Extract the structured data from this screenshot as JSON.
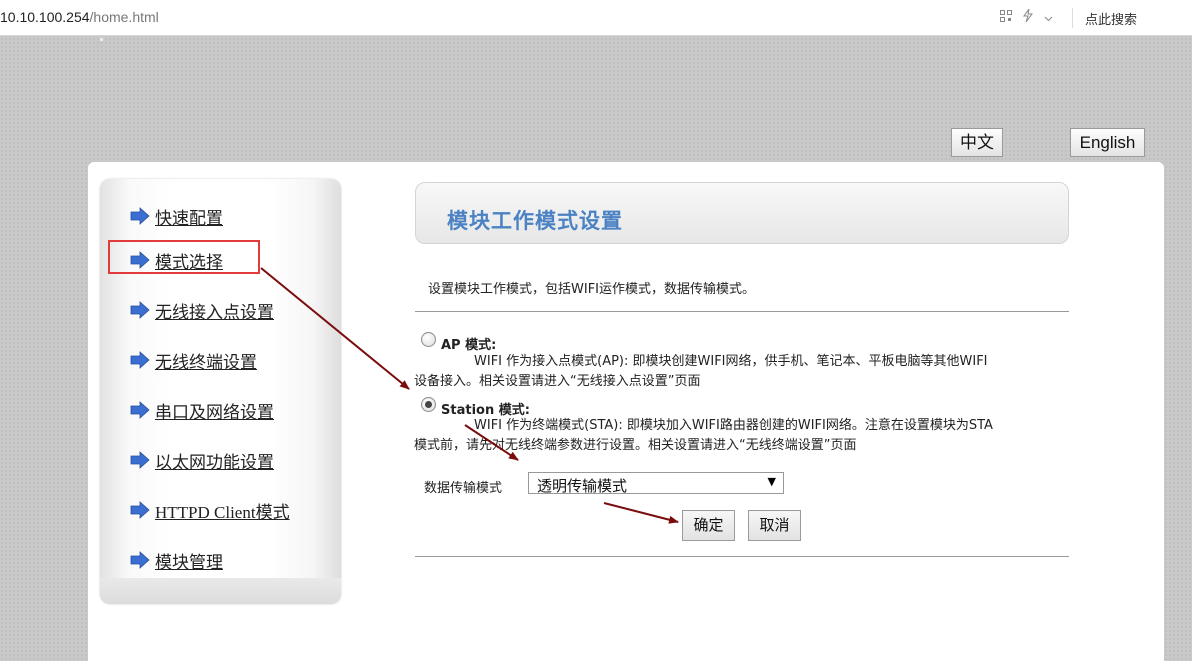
{
  "browser": {
    "url_host": "10.10.100.254",
    "url_path": "/home.html",
    "search_label": "点此搜索",
    "icons": [
      "qr-code-icon",
      "lightning-icon",
      "chevron-down-icon"
    ]
  },
  "language": {
    "zh_label": "中文",
    "en_label": "English"
  },
  "sidebar": {
    "items": [
      {
        "label": "快速配置"
      },
      {
        "label": "模式选择"
      },
      {
        "label": "无线接入点设置"
      },
      {
        "label": "无线终端设置"
      },
      {
        "label": "串口及网络设置"
      },
      {
        "label": "以太网功能设置"
      },
      {
        "label": "HTTPD Client模式"
      },
      {
        "label": "模块管理"
      }
    ],
    "highlighted_item": "模式选择",
    "arrow_color": "#3a6fd1"
  },
  "main": {
    "title": "模块工作模式设置",
    "description": "设置模块工作模式，包括WIFI运作模式，数据传输模式。",
    "ap_mode": {
      "title": "AP 模式:",
      "desc_line1": "WIFI 作为接入点模式(AP): 即模块创建WIFI网络，供手机、笔记本、平板电脑等其他WIFI",
      "desc_line2": "设备接入。相关设置请进入“无线接入点设置”页面",
      "selected": false
    },
    "station_mode": {
      "title": "Station 模式:",
      "desc_line1": "WIFI 作为终端模式(STA): 即模块加入WIFI路由器创建的WIFI网络。注意在设置模块为STA",
      "desc_line2": "模式前，请先对无线终端参数进行设置。相关设置请进入“无线终端设置”页面",
      "selected": true
    },
    "transfer_mode_label": "数据传输模式",
    "transfer_mode_value": "透明传输模式",
    "ok_label": "确定",
    "cancel_label": "取消"
  },
  "colors": {
    "title_blue": "#4b82c3",
    "highlight_red": "#e23b3b",
    "annotation_arrow": "#7a0c0c"
  }
}
